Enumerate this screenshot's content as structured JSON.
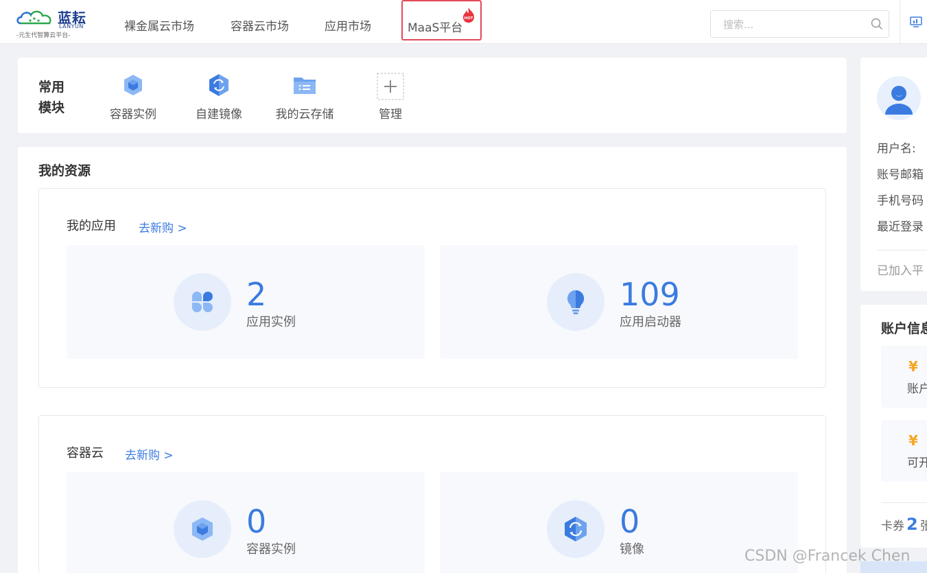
{
  "logo": {
    "main": "蓝耘",
    "en": "LANYUN",
    "sub": "-元生代智算云平台-"
  },
  "nav": {
    "items": [
      "裸金属云市场",
      "容器云市场",
      "应用市场"
    ],
    "maas": "MaaS平台",
    "hot": "HOT"
  },
  "search": {
    "placeholder": "搜索..."
  },
  "quick": {
    "title": "常用模块",
    "items": [
      {
        "label": "容器实例",
        "icon": "cube-icon"
      },
      {
        "label": "自建镜像",
        "icon": "image-icon"
      },
      {
        "label": "我的云存储",
        "icon": "folder-icon"
      },
      {
        "label": "管理",
        "icon": "plus-icon"
      }
    ]
  },
  "resources": {
    "title": "我的资源",
    "apps": {
      "title": "我的应用",
      "link": "去新购 >",
      "cards": [
        {
          "value": "2",
          "label": "应用实例",
          "icon": "clover-icon"
        },
        {
          "value": "109",
          "label": "应用启动器",
          "icon": "lightbulb-icon"
        }
      ]
    },
    "container": {
      "title": "容器云",
      "link": "去新购 >",
      "cards": [
        {
          "value": "0",
          "label": "容器实例",
          "icon": "cube-icon"
        },
        {
          "value": "0",
          "label": "镜像",
          "icon": "image-icon"
        }
      ]
    }
  },
  "user": {
    "fields": [
      "用户名:",
      "账号邮箱",
      "手机号码",
      "最近登录"
    ],
    "footer": "已加入平"
  },
  "account": {
    "title": "账户信息",
    "cards": [
      {
        "yen": "¥",
        "label": "账户"
      },
      {
        "yen": "¥",
        "label": "可开"
      }
    ],
    "coupon_prefix": "卡券",
    "coupon_count": "2",
    "coupon_suffix": "张"
  },
  "watermark": "CSDN @Francek Chen",
  "colors": {
    "accent": "#3b7be0",
    "highlight_border": "#e0495a",
    "yen": "#f5a623"
  }
}
